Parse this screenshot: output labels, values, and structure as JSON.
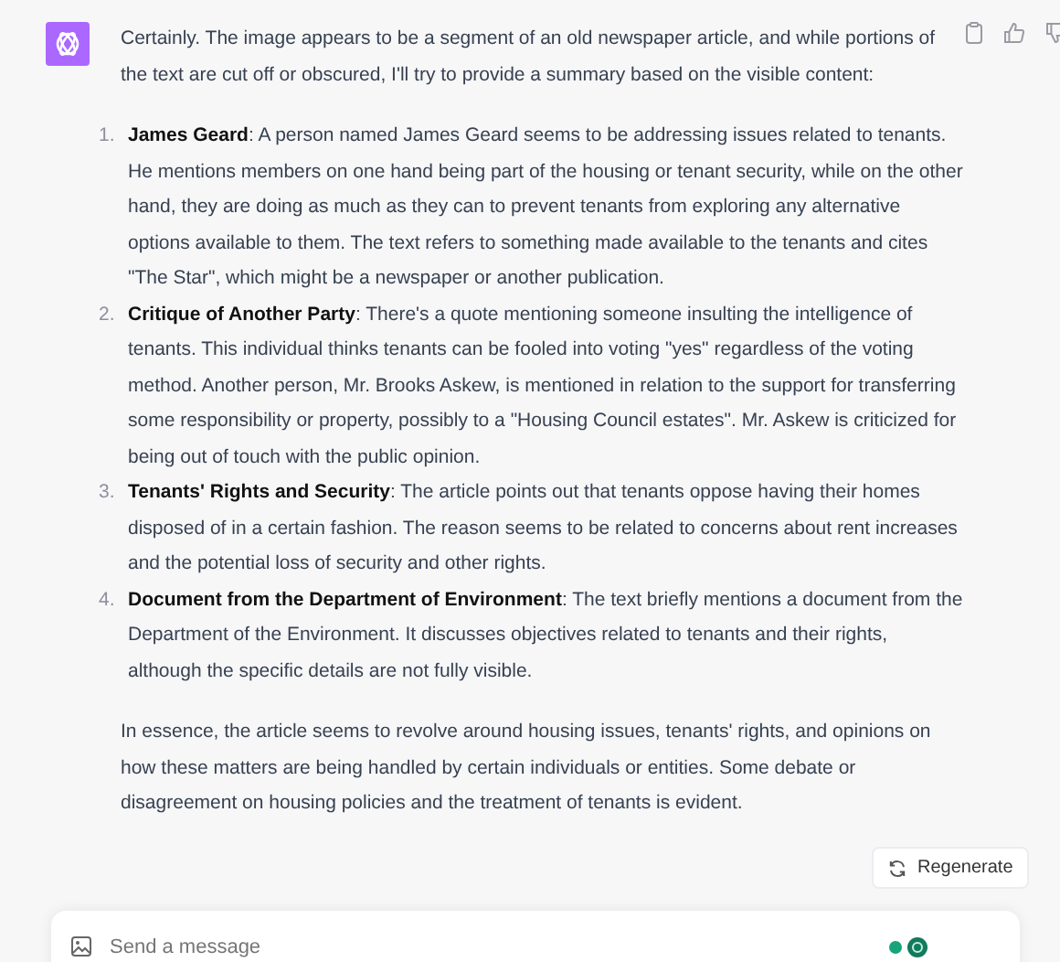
{
  "message": {
    "intro": "Certainly. The image appears to be a segment of an old newspaper article, and while portions of the text are cut off or obscured, I'll try to provide a summary based on the visible content:",
    "items": [
      {
        "number": "1.",
        "text": "**James Geard**: A person named James Geard seems to be addressing issues related to tenants. He mentions members on one hand being part of the housing or tenant security, while on the other hand, they are doing as much as they can to prevent tenants from exploring any alternative options available to them. The text refers to something made available to the tenants and cites \"The Star\", which might be a newspaper or another publication."
      },
      {
        "number": "2.",
        "text": "**Critique of Another Party**: There's a quote mentioning someone insulting the intelligence of tenants. This individual thinks tenants can be fooled into voting \"yes\" regardless of the voting method. Another person, Mr. Brooks Askew, is mentioned in relation to the support for transferring some responsibility or property, possibly to a \"Housing Council estates\". Mr. Askew is criticized for being out of touch with the public opinion."
      },
      {
        "number": "3.",
        "text": "**Tenants' Rights and Security**: The article points out that tenants oppose having their homes disposed of in a certain fashion. The reason seems to be related to concerns about rent increases and the potential loss of security and other rights."
      },
      {
        "number": "4.",
        "text": "**Document from the Department of Environment**: The text briefly mentions a document from the Department of the Environment. It discusses objectives related to tenants and their rights, although the specific details are not fully visible."
      }
    ],
    "conclusion": "In essence, the article seems to revolve around housing issues, tenants' rights, and opinions on how these matters are being handled by certain individuals or entities. Some debate or disagreement on housing policies and the treatment of tenants is evident."
  },
  "regenerate_button": "Regenerate",
  "composer": {
    "placeholder": "Send a message"
  }
}
